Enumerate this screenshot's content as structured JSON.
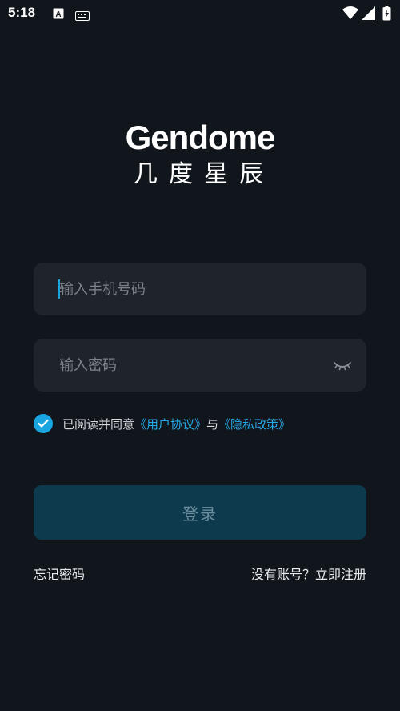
{
  "status_bar": {
    "time": "5:18",
    "icons": [
      "a-letter-icon",
      "keyboard-icon",
      "wifi-icon",
      "signal-icon",
      "battery-icon"
    ]
  },
  "logo": {
    "brand_en": "Gendome",
    "brand_cn": "几度星辰"
  },
  "phone_field": {
    "placeholder": "输入手机号码",
    "value": ""
  },
  "password_field": {
    "placeholder": "输入密码",
    "value": "",
    "toggle_icon": "eye-closed-icon"
  },
  "agreement": {
    "checked": true,
    "prefix": "已阅读并同意",
    "user_agreement": "《用户协议》",
    "conjunction": "与",
    "privacy_policy": "《隐私政策》"
  },
  "login_button": {
    "label": "登录"
  },
  "links": {
    "forgot_password": "忘记密码",
    "register": "没有账号？立即注册"
  },
  "colors": {
    "background": "#11161d",
    "field_background": "#1f242c",
    "accent": "#1aa5e0",
    "button_background": "#0e3a4d"
  }
}
